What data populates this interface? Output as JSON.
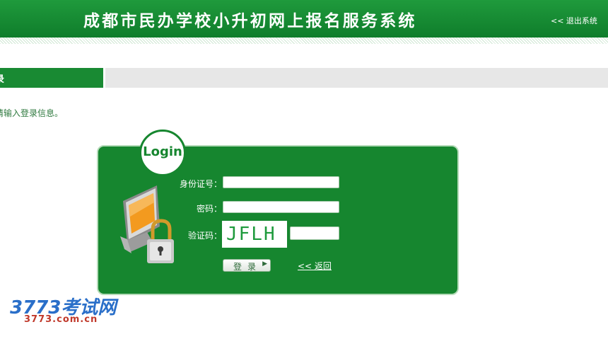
{
  "header": {
    "title": "成都市民办学校小升初网上报名服务系统",
    "logout_label": "<< 退出系统",
    "bg_color": "#14862f"
  },
  "section": {
    "tab_label": "录",
    "hint": "请输入登录信息。"
  },
  "login": {
    "badge_label": "Login",
    "id_label": "身份证号：",
    "id_value": "",
    "password_label": "密码：",
    "password_value": "",
    "captcha_label": "验证码：",
    "captcha_value": "",
    "captcha_image_text": "JFLH",
    "submit_label": "登录",
    "back_label": "<< 返回",
    "panel_color": "#16862f"
  },
  "watermark": {
    "brand": "3773考试网",
    "domain": "3773.com.cn"
  },
  "icons": {
    "computer": "computer-lock-icon",
    "submit_arrow": "play-arrow-icon"
  }
}
